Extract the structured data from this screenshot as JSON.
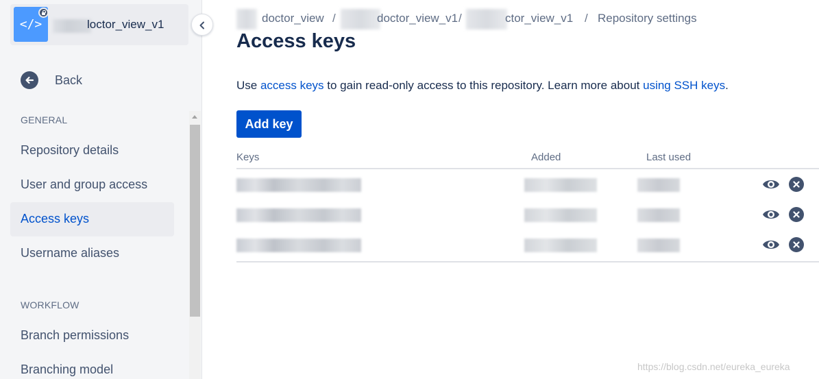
{
  "sidebar": {
    "repo_name": "loctor_view_v1",
    "repo_avatar_glyph": "</>",
    "back_label": "Back",
    "sections": [
      {
        "title": "GENERAL",
        "items": [
          {
            "label": "Repository details",
            "active": false
          },
          {
            "label": "User and group access",
            "active": false
          },
          {
            "label": "Access keys",
            "active": true
          },
          {
            "label": "Username aliases",
            "active": false
          }
        ]
      },
      {
        "title": "WORKFLOW",
        "items": [
          {
            "label": "Branch permissions",
            "active": false
          },
          {
            "label": "Branching model",
            "active": false
          }
        ]
      }
    ]
  },
  "breadcrumb": {
    "items": [
      "doctor_view",
      "doctor_view_v1",
      "ctor_view_v1",
      "Repository settings"
    ],
    "separator": "/"
  },
  "main": {
    "title": "Access keys",
    "description": {
      "prefix": "Use ",
      "link1": "access keys",
      "middle": " to gain read-only access to this repository. Learn more about ",
      "link2": "using SSH keys",
      "suffix": "."
    },
    "add_button": "Add key",
    "table": {
      "headers": [
        "Keys",
        "Added",
        "Last used"
      ],
      "rows": [
        {
          "actions": [
            "eye-icon",
            "close-icon"
          ]
        },
        {
          "actions": [
            "eye-icon",
            "close-icon"
          ]
        },
        {
          "actions": [
            "eye-icon",
            "close-icon"
          ]
        }
      ]
    }
  },
  "watermark": "https://blog.csdn.net/eureka_eureka",
  "colors": {
    "primary": "#0052CC",
    "sidebar_bg": "#F4F5F7",
    "text": "#172B4D",
    "muted": "#5E6C84",
    "icon": "#42526E",
    "avatar": "#4C9AFF"
  }
}
